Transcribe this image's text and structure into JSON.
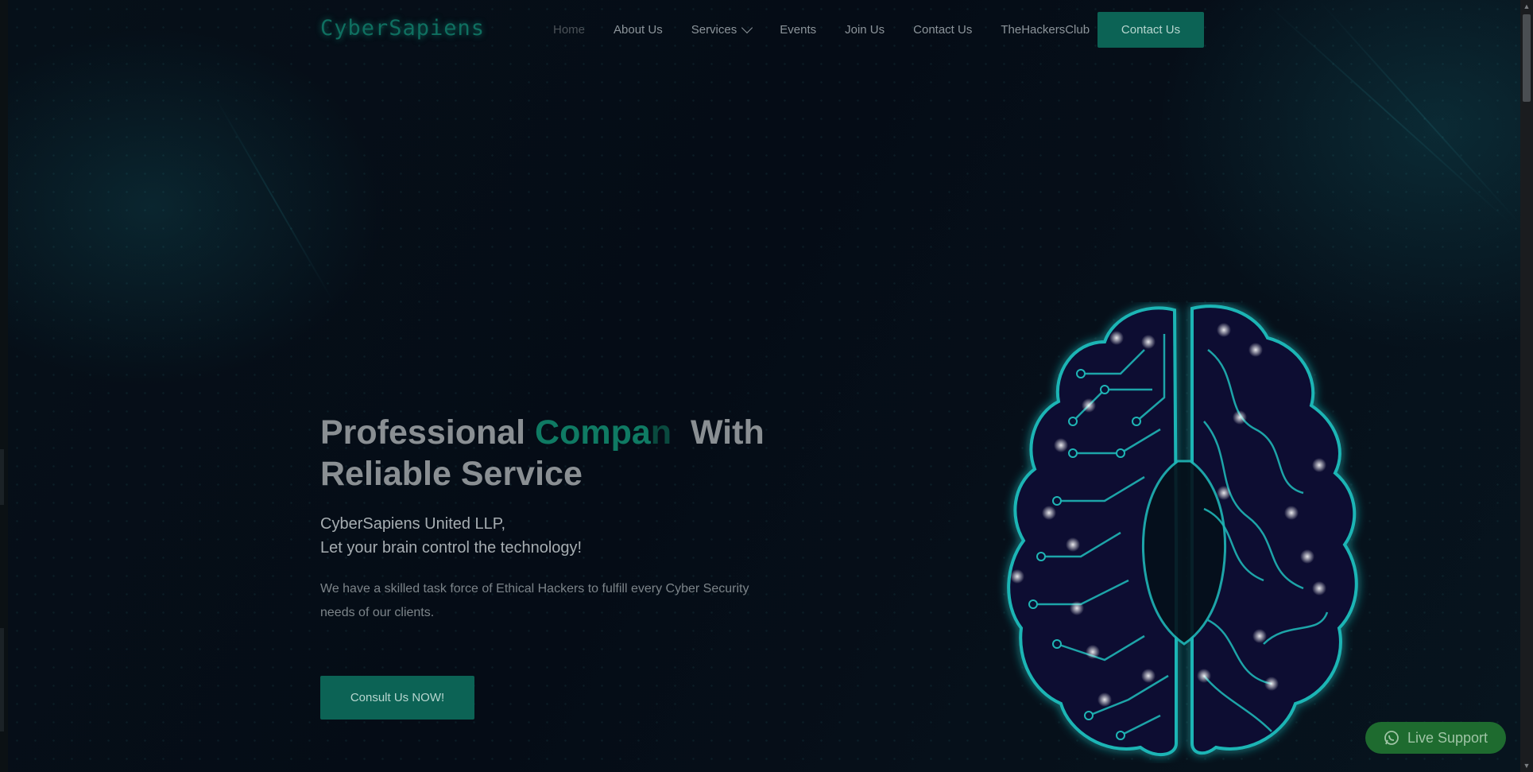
{
  "brand": {
    "logo_text": "CyberSapiens"
  },
  "nav": {
    "items": [
      {
        "label": "Home",
        "active": true
      },
      {
        "label": "About Us"
      },
      {
        "label": "Services",
        "has_dropdown": true
      },
      {
        "label": "Events"
      },
      {
        "label": "Join Us"
      },
      {
        "label": "Contact Us"
      },
      {
        "label": "TheHackersClub"
      }
    ],
    "cta_label": "Contact Us"
  },
  "hero": {
    "title_prefix": "Professional",
    "title_accent": "Compa",
    "title_accent_fading": "n",
    "title_suffix": "With",
    "title_line2": "Reliable Service",
    "subtitle_line1": "CyberSapiens United LLP,",
    "subtitle_line2": "Let your brain control the technology!",
    "description": "We have a skilled task force of Ethical Hackers to fulfill every Cyber Security needs of our clients.",
    "cta_label": "Consult Us NOW!"
  },
  "live_support": {
    "label": "Live Support",
    "icon": "whatsapp-icon"
  },
  "colors": {
    "accent": "#0f7a63",
    "button": "#0c6355",
    "brain_glow": "#1fb5b5",
    "live_support": "#1e6b2f"
  }
}
